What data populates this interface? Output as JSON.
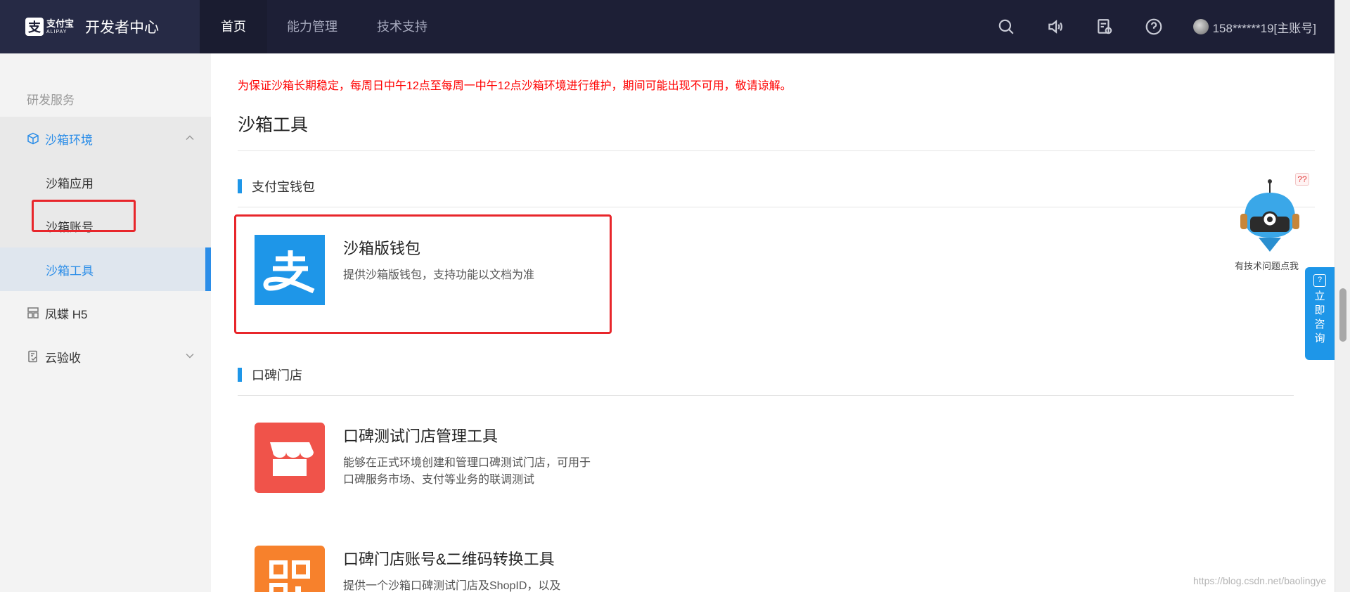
{
  "header": {
    "brand_cn": "支付宝",
    "brand_en": "ALIPAY",
    "title": "开发者中心",
    "nav": [
      {
        "label": "首页",
        "active": true
      },
      {
        "label": "能力管理",
        "active": false
      },
      {
        "label": "技术支持",
        "active": false
      }
    ],
    "icons": [
      "search-icon",
      "speaker-icon",
      "doc-icon",
      "help-icon"
    ],
    "account": "158******19[主账号]"
  },
  "sidebar": {
    "group_title": "研发服务",
    "items": [
      {
        "label": "沙箱环境",
        "icon": "cube-icon",
        "open": true,
        "children": [
          {
            "label": "沙箱应用"
          },
          {
            "label": "沙箱账号"
          },
          {
            "label": "沙箱工具",
            "active": true
          }
        ]
      },
      {
        "label": "凤蝶 H5",
        "icon": "grid-icon"
      },
      {
        "label": "云验收",
        "icon": "check-doc-icon"
      }
    ]
  },
  "main": {
    "notice": "为保证沙箱长期稳定，每周日中午12点至每周一中午12点沙箱环境进行维护，期间可能出现不可用，敬请谅解。",
    "page_title": "沙箱工具",
    "sections": [
      {
        "title": "支付宝钱包",
        "tools": [
          {
            "name": "沙箱版钱包",
            "desc": "提供沙箱版钱包，支持功能以文档为准",
            "icon": "alipay-icon",
            "color": "#1e96e8"
          }
        ]
      },
      {
        "title": "口碑门店",
        "tools": [
          {
            "name": "口碑测试门店管理工具",
            "desc": "能够在正式环境创建和管理口碑测试门店，可用于口碑服务市场、支付等业务的联调测试",
            "icon": "store-icon",
            "color": "#f0534a"
          },
          {
            "name": "口碑门店账号&二维码转换工具",
            "desc": "提供一个沙箱口碑测试门店及ShopID，以及",
            "icon": "qrcode-icon",
            "color": "#f7812c"
          }
        ]
      }
    ]
  },
  "help": {
    "badge": "??",
    "text": "有技术问题点我",
    "consult": [
      "立",
      "即",
      "咨",
      "询"
    ]
  },
  "watermark": "https://blog.csdn.net/baolingye",
  "colors": {
    "accent": "#1e96e8",
    "header_bg": "#1d1f36",
    "notice": "#ff0000",
    "highlight": "#e8262b"
  }
}
